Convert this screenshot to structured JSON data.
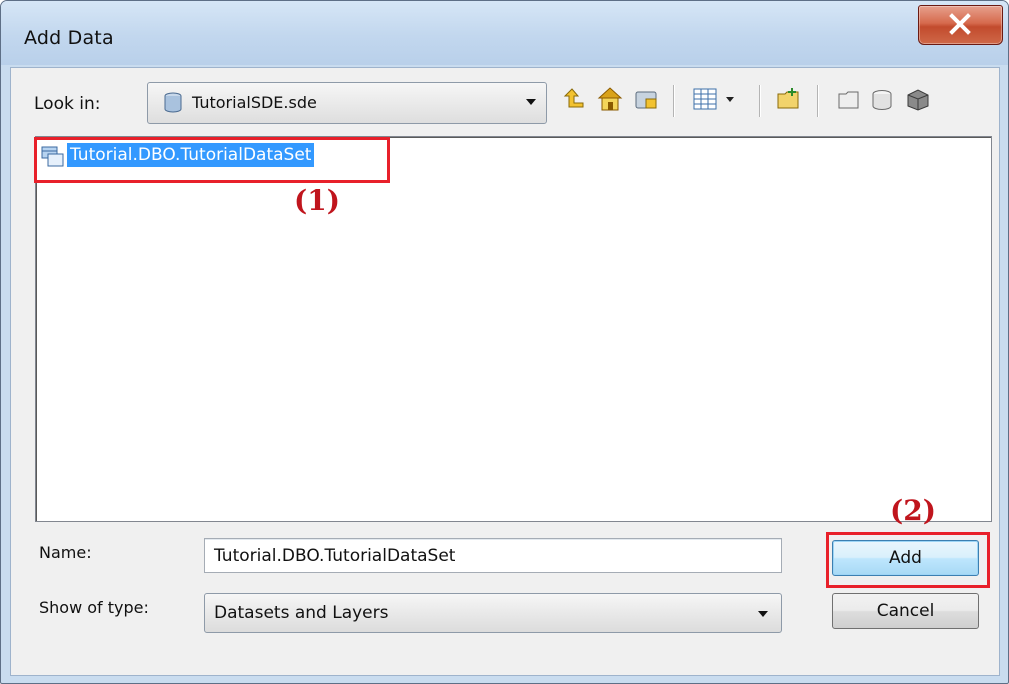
{
  "window": {
    "title": "Add Data",
    "close_icon": "close-icon"
  },
  "look_in": {
    "label": "Look in:",
    "value": "TutorialSDE.sde",
    "icon": "database-icon"
  },
  "toolbar": {
    "icons": [
      "up-one-level-icon",
      "home-icon",
      "connect-folder-icon",
      "view-menu-icon",
      "new-folder-icon",
      "new-item-icon",
      "new-database-icon",
      "new-server-icon"
    ]
  },
  "file_list": {
    "items": [
      {
        "label": "Tutorial.DBO.TutorialDataSet",
        "icon": "feature-dataset-icon",
        "selected": true
      }
    ]
  },
  "form": {
    "name_label": "Name:",
    "name_value": "Tutorial.DBO.TutorialDataSet",
    "type_label": "Show of type:",
    "type_value": "Datasets and Layers"
  },
  "buttons": {
    "add_label": "Add",
    "cancel_label": "Cancel"
  },
  "annotations": {
    "callout_1": "(1)",
    "callout_2": "(2)",
    "highlight_color": "#e8202a"
  }
}
